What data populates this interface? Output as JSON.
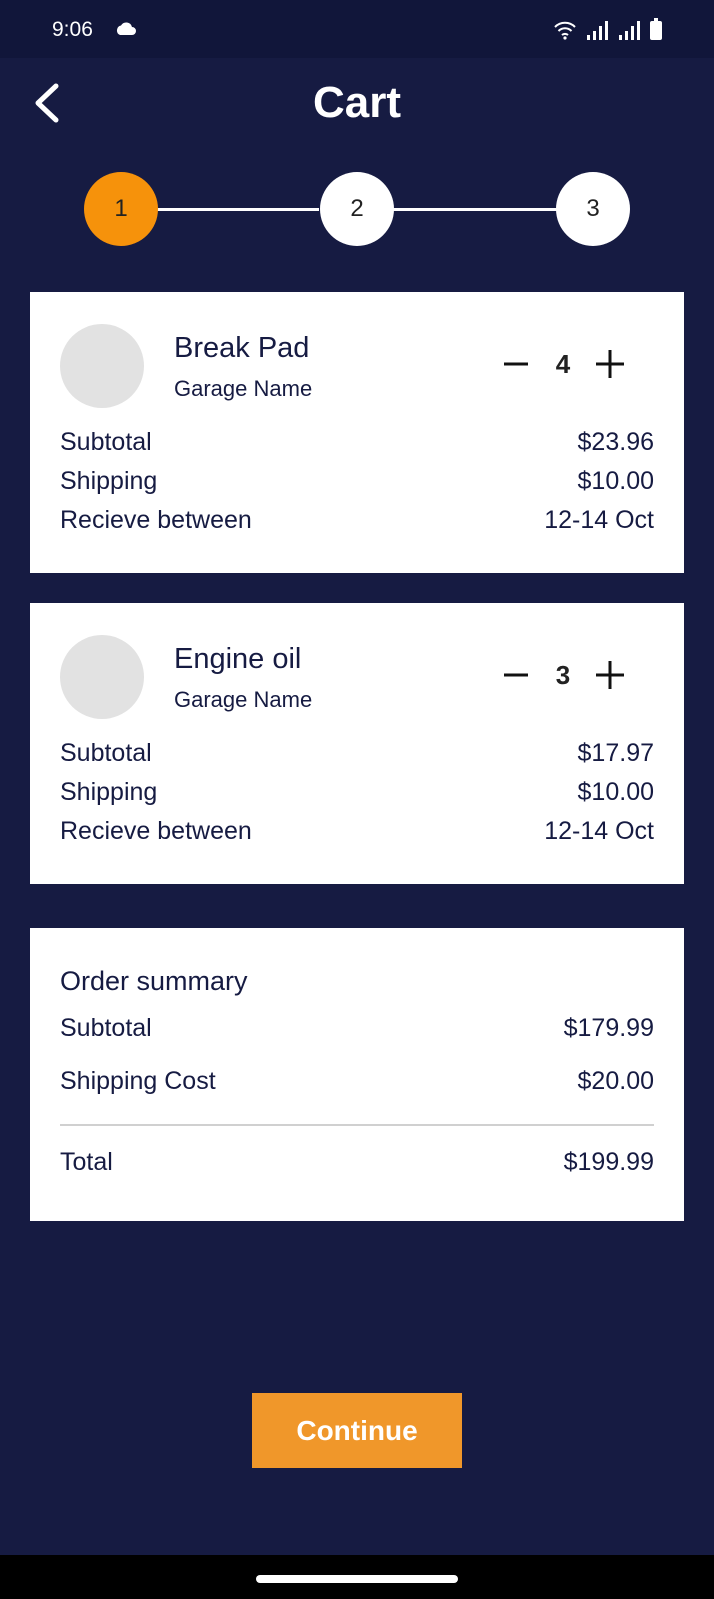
{
  "status_bar": {
    "time": "9:06"
  },
  "header": {
    "title": "Cart"
  },
  "stepper": {
    "steps": [
      "1",
      "2",
      "3"
    ],
    "active_step": 1
  },
  "items": [
    {
      "name": "Break Pad",
      "garage": "Garage Name",
      "quantity": "4",
      "subtotal_label": "Subtotal",
      "subtotal": "$23.96",
      "shipping_label": "Shipping",
      "shipping": "$10.00",
      "receive_label": "Recieve between",
      "receive": "12-14 Oct"
    },
    {
      "name": "Engine oil",
      "garage": "Garage Name",
      "quantity": "3",
      "subtotal_label": "Subtotal",
      "subtotal": "$17.97",
      "shipping_label": "Shipping",
      "shipping": "$10.00",
      "receive_label": "Recieve between",
      "receive": "12-14 Oct"
    }
  ],
  "summary": {
    "title": "Order summary",
    "subtotal_label": "Subtotal",
    "subtotal": "$179.99",
    "shipping_label": "Shipping Cost",
    "shipping": "$20.00",
    "total_label": "Total",
    "total": "$199.99"
  },
  "actions": {
    "continue_label": "Continue"
  },
  "colors": {
    "background": "#161b42",
    "accent": "#f6920b",
    "button": "#f0972a"
  }
}
